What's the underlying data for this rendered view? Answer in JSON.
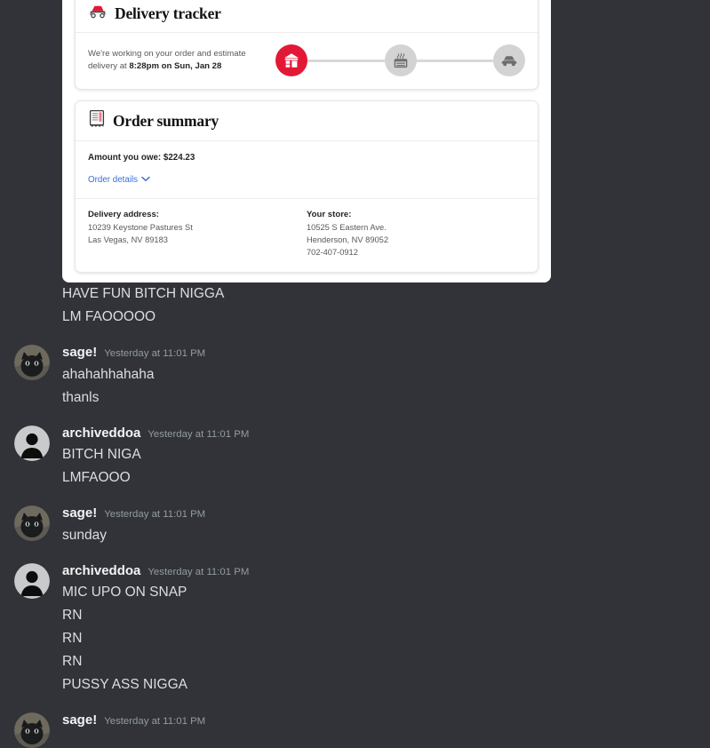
{
  "attachment": {
    "name": "delivery-order-screenshot",
    "tracker": {
      "icon": "delivery-car-icon",
      "title": "Delivery tracker",
      "message_prefix": "We're working on your order and estimate delivery at ",
      "message_time": "8:28pm on Sun, Jan 28",
      "steps": [
        {
          "icon": "store-icon",
          "state": "active"
        },
        {
          "icon": "oven-cooking-icon",
          "state": "idle"
        },
        {
          "icon": "car-delivery-icon",
          "state": "idle"
        }
      ]
    },
    "summary": {
      "icon": "receipt-icon",
      "title": "Order summary",
      "amount_label": "Amount you owe: $224.23",
      "order_details_link": "Order details",
      "delivery": {
        "label": "Delivery address:",
        "lines": [
          "10239 Keystone Pastures St",
          "Las Vegas, NV 89183"
        ]
      },
      "store": {
        "label": "Your store:",
        "lines": [
          "10525 S Eastern Ave.",
          "Henderson, NV 89052",
          "702-407-0912"
        ]
      }
    }
  },
  "chat": {
    "orphan_lines": [
      "HAVE FUN BITCH NIGGA",
      "LM FAOOOOO"
    ],
    "groups": [
      {
        "author": "sage!",
        "timestamp": "Yesterday at 11:01 PM",
        "avatar": "black-cat-avatar",
        "lines": [
          "ahahahhahaha",
          "thanls"
        ]
      },
      {
        "author": "archiveddoa",
        "timestamp": "Yesterday at 11:01 PM",
        "avatar": "default-user-avatar",
        "lines": [
          "BITCH NIGA",
          "LMFAOOO"
        ]
      },
      {
        "author": "sage!",
        "timestamp": "Yesterday at 11:01 PM",
        "avatar": "black-cat-avatar",
        "lines": [
          "sunday"
        ]
      },
      {
        "author": "archiveddoa",
        "timestamp": "Yesterday at 11:01 PM",
        "avatar": "default-user-avatar",
        "lines": [
          "MIC UPO ON SNAP",
          "RN",
          "RN",
          "RN",
          "PUSSY ASS NIGGA"
        ]
      },
      {
        "author": "sage!",
        "timestamp": "Yesterday at 11:01 PM",
        "avatar": "black-cat-avatar",
        "lines": []
      }
    ]
  },
  "colors": {
    "chat_background": "#313338",
    "brand_red": "#e31837",
    "link_blue": "#3a6fd8",
    "text_primary": "#dbdee1",
    "text_muted": "#949ba4"
  }
}
